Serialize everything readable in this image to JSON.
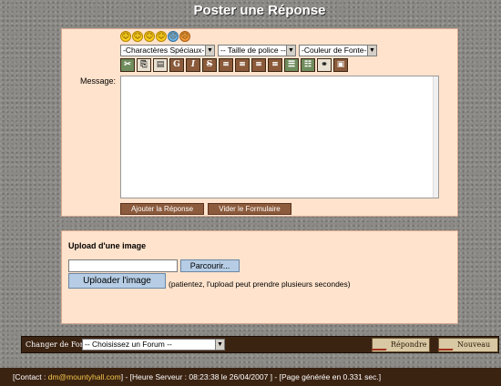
{
  "page_title": "Poster une Réponse",
  "smileys": [
    "smiley-happy",
    "smiley-grin",
    "smiley-laugh",
    "smiley-wink",
    "smiley-sad",
    "smiley-angry"
  ],
  "selects": {
    "special_chars": "-Charactères Spéciaux-",
    "font_size": "-- Taille de police --",
    "font_color": "-Couleur de Fonte-"
  },
  "toolbar": [
    {
      "name": "cut-icon",
      "glyph": "✂"
    },
    {
      "name": "copy-icon",
      "glyph": "⎘"
    },
    {
      "name": "paste-icon",
      "glyph": "📋"
    },
    {
      "name": "bold-icon",
      "glyph": "G"
    },
    {
      "name": "italic-icon",
      "glyph": "I"
    },
    {
      "name": "strike-icon",
      "glyph": "S"
    },
    {
      "name": "align-left-icon",
      "glyph": "≡"
    },
    {
      "name": "align-center-icon",
      "glyph": "≡"
    },
    {
      "name": "align-right-icon",
      "glyph": "≡"
    },
    {
      "name": "justify-icon",
      "glyph": "≡"
    },
    {
      "name": "list-icon",
      "glyph": "☰"
    },
    {
      "name": "indent-icon",
      "glyph": "☷"
    },
    {
      "name": "link-icon",
      "glyph": "🔗"
    },
    {
      "name": "image-icon",
      "glyph": "▣"
    }
  ],
  "message_label": "Message:",
  "message_value": "",
  "buttons": {
    "add_reply": "Ajouter la Réponse",
    "clear_form": "Vider le Formulaire"
  },
  "upload": {
    "title": "Upload d'une image",
    "file_value": "",
    "browse": "Parcourir...",
    "upload_button": "Uploader l'image",
    "note": "(patientez, l'upload peut prendre plusieurs secondes)"
  },
  "forum_bar": {
    "label": "Changer de Forum",
    "select_value": "-- Choisissez un Forum --",
    "reply": "Répondre",
    "new": "Nouveau"
  },
  "footer": {
    "contact_prefix": "[Contact : ",
    "email": "dm@mountyhall.com",
    "rest": "] - [Heure Serveur : 08:23:38 le 26/04/2007 ] - [Page générée en 0.331 sec.]"
  }
}
